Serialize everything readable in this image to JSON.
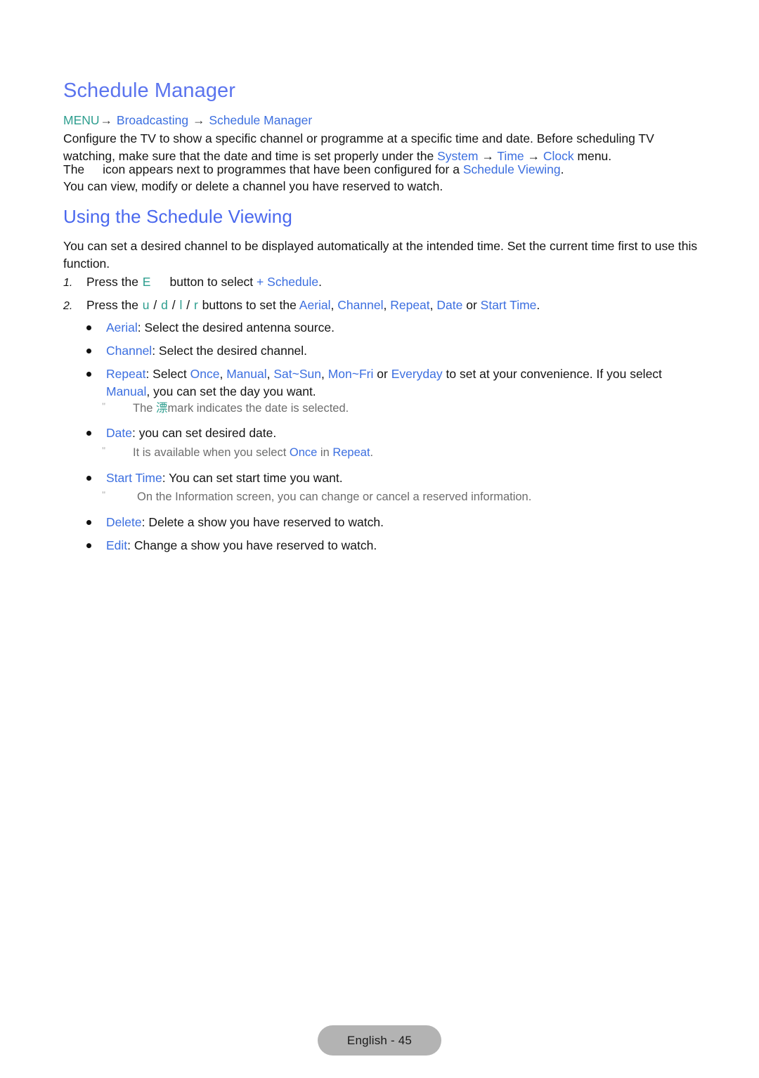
{
  "document": {
    "title": "Schedule Manager",
    "section_title": "Using the Schedule Viewing"
  },
  "breadcrumb": {
    "menu": "MENU",
    "arrow": "→",
    "item1": "Broadcasting",
    "item2": "Schedule Manager"
  },
  "intro": {
    "line1_a": "Configure the TV to show a specific channel or programme at a specific time and date. Before scheduling TV watching, make sure that the date and time is set properly under the ",
    "system": "System",
    "arrow1": " → ",
    "time": "Time",
    "arrow2": " → ",
    "clock": "Clock",
    "line1_b": " menu.",
    "line2_a": "The",
    "line2_b": "icon appears next to programmes that have been configured for a ",
    "schedule_viewing": "Schedule Viewing",
    "line2_c": ".",
    "line3": "You can view, modify or delete a channel you have reserved to watch."
  },
  "using": {
    "paragraph": "You can set a desired channel to be displayed automatically at the intended time. Set the current time first to use this function."
  },
  "steps": [
    {
      "number": "1.",
      "text_a": "Press the ",
      "key": "E",
      "text_b": "button to select ",
      "plus": "+",
      "target": "Schedule",
      "text_c": "."
    },
    {
      "number": "2.",
      "text_a": "Press the ",
      "key_u": "u",
      "sep1": " / ",
      "key_d": "d",
      "sep2": " / ",
      "key_l": "l",
      "sep3": " / ",
      "key_r": "r",
      "text_b": " buttons to set the ",
      "opt_aerial": "Aerial",
      "comma1": ", ",
      "opt_channel": "Channel",
      "comma2": ", ",
      "opt_repeat": "Repeat",
      "comma3": ", ",
      "opt_date": "Date",
      "or": " or ",
      "opt_starttime": "Start Time",
      "period": "."
    }
  ],
  "bullets": {
    "aerial": {
      "label": "Aerial",
      "text": ": Select the desired antenna source."
    },
    "channel": {
      "label": "Channel",
      "text": ": Select the desired channel."
    },
    "repeat": {
      "label": "Repeat",
      "text_a": ": Select ",
      "opt1": "Once",
      "c1": ", ",
      "opt2": "Manual",
      "c2": ", ",
      "opt3": "Sat~Sun",
      "c3": ", ",
      "opt4": "Mon~Fri",
      "or": " or ",
      "opt5": "Everyday",
      "text_b": " to set at your convenience. If you select ",
      "opt6": "Manual",
      "text_c": ", you can set the day you want."
    },
    "date": {
      "label": "Date",
      "text": ": you can set desired date."
    },
    "start_time": {
      "label": "Start Time",
      "text": ": You can set start time you want."
    },
    "delete": {
      "label": "Delete",
      "text": ": Delete a show you have reserved to watch."
    },
    "edit": {
      "label": "Edit",
      "text": ": Change a show you have reserved to watch."
    }
  },
  "notes": {
    "mark": {
      "text_a": "The ",
      "glyph": "漂",
      "text_b": "mark indicates the date is selected."
    },
    "once_in_repeat": {
      "text_a": "It is available when you select ",
      "once": "Once",
      "text_b": " in ",
      "repeat": "Repeat",
      "text_c": "."
    },
    "information": {
      "text": "On the Information screen, you can change or cancel a reserved information."
    }
  },
  "footer": {
    "label": "English - 45"
  },
  "colors": {
    "heading_blue": "#5b74ee",
    "link_blue": "#3c6fe0",
    "key_teal": "#2e9e8f",
    "note_gray": "#6d6d6d",
    "footer_bg": "#b3b3b3"
  }
}
